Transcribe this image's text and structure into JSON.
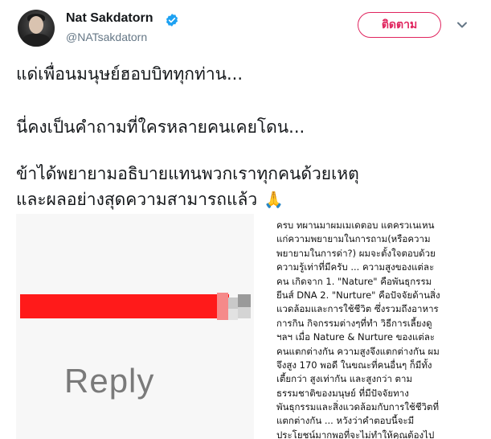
{
  "user": {
    "display_name": "Nat Sakdatorn",
    "handle": "@NATsakdatorn",
    "verified_icon": "verified-badge-icon",
    "avatar_icon": "profile-photo"
  },
  "actions": {
    "follow_label": "ติดตาม",
    "menu_icon": "chevron-down-icon"
  },
  "tweet": {
    "lines": [
      "แด่เพื่อนมนุษย์ฮอบบิททุกท่าน...",
      "นี่คงเป็นคำถามที่ใครหลายคนเคยโดน...",
      "ข้าได้พยายามอธิบายแทนพวกเราทุกคนด้วยเหตุ",
      "และผลอย่างสุดความสามารถแล้ว"
    ],
    "emoji": "🙏"
  },
  "media": {
    "left_caption": "Reply",
    "right_text_lines": [
      "ครบ ทผานมาผมเมเดตอบ แตครวเนเหน",
      "แก่ความพยายามในการถาม(หรือความ",
      "พยายามในการด่า?) ผมจะตั้งใจตอบด้วย",
      "ความรู้เท่าที่มีครับ ... ความสูงของแต่ละ",
      "คน เกิดจาก 1. \"Nature\" คือพันธุกรรม",
      "ยีนส์ DNA 2. \"Nurture\" คือปัจจัยด้านสิ่ง",
      "แวดล้อมและการใช้ชีวิต ซึ่งรวมถึงอาหาร",
      "การกิน กิจกรรมต่างๆที่ทำ วิธีการเลี้ยงดู",
      "ฯลฯ เมื่อ Nature & Nurture ของแต่ละ",
      "คนแตกต่างกัน ความสูงจึงแตกต่างกัน ผม",
      "จึงสูง 170 พอดี ในขณะที่คนอื่นๆ ก็มีทั้ง",
      "เตี้ยกว่า สูงเท่ากัน และสูงกว่า ตาม",
      "ธรรมชาติของมนุษย์ ที่มีปัจจัยทาง",
      "พันธุกรรมและสิ่งแวดล้อมกับการใช้ชีวิตที่",
      "แตกต่างกัน ... หวังว่าคำตอบนี้จะมี",
      "ประโยชน์มากพอที่จะไม่ทำให้คุณต้องไป"
    ]
  },
  "colors": {
    "follow_accent": "#e0245e",
    "verified_blue": "#1da1f2",
    "pixel_red": "#ff1a1a"
  }
}
